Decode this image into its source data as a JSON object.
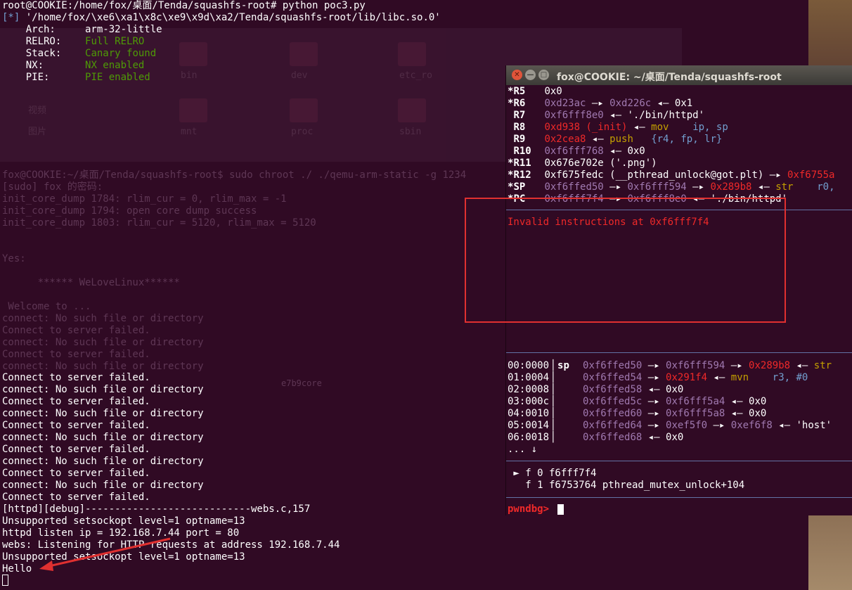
{
  "back_terminal": {
    "lines": [
      "root@COOKIE:/home/fox/桌面/Tenda/squashfs-root# python poc3.py",
      "[*] '/home/fox/\\xe6\\xa1\\x8c\\xe9\\x9d\\xa2/Tenda/squashfs-root/lib/libc.so.0'",
      "    Arch:     arm-32-little",
      "    RELRO:    Full RELRO",
      "    Stack:    Canary found",
      "    NX:       NX enabled",
      "    PIE:      PIE enabled"
    ],
    "ghost": {
      "folders": [
        "bin",
        "dev",
        "etc_ro",
        "mnt",
        "proc",
        "sbin"
      ],
      "sidebar": [
        "视频",
        "图片"
      ],
      "lines": [
        "fox@COOKIE:~/桌面/Tenda/squashfs-root$ sudo chroot ./ ./qemu-arm-static -g 1234",
        "[sudo] fox 的密码:",
        "init_core_dump 1784: rlim_cur = 0, rlim_max = -1",
        "init_core_dump 1794: open core dump success",
        "init_core_dump 1803: rlim_cur = 5120, rlim_max = 5120",
        "Yes:",
        "      ****** WeLoveLinux******",
        " Welcome to ...",
        "connect: No such file or directory",
        "Connect to server failed.",
        "connect: No such file or directory",
        "Connect to server failed.",
        "connect: No such file or directory"
      ],
      "file_label": "e7b9core"
    },
    "output": [
      "Connect to server failed.",
      "connect: No such file or directory",
      "Connect to server failed.",
      "connect: No such file or directory",
      "Connect to server failed.",
      "connect: No such file or directory",
      "Connect to server failed.",
      "connect: No such file or directory",
      "Connect to server failed.",
      "connect: No such file or directory",
      "Connect to server failed.",
      "[httpd][debug]----------------------------webs.c,157",
      "Unsupported setsockopt level=1 optname=13",
      "httpd listen ip = 192.168.7.44 port = 80",
      "webs: Listening for HTTP requests at address 192.168.7.44",
      "Unsupported setsockopt level=1 optname=13",
      "Hello"
    ]
  },
  "gdb_window": {
    "title": "fox@COOKIE: ~/桌面/Tenda/squashfs-root",
    "close_glyph": "✕",
    "min_glyph": "—",
    "max_glyph": "□",
    "registers": [
      {
        "star": "*",
        "name": "R5",
        "parts": [
          {
            "t": "0x0",
            "c": "w"
          }
        ]
      },
      {
        "star": "*",
        "name": "R6",
        "parts": [
          {
            "t": "0xd23ac",
            "c": "p"
          },
          {
            "t": " —▸ ",
            "c": "w"
          },
          {
            "t": "0xd226c",
            "c": "p"
          },
          {
            "t": " ◂— 0x1",
            "c": "w"
          }
        ]
      },
      {
        "star": " ",
        "name": "R7",
        "parts": [
          {
            "t": "0xf6fff8e0",
            "c": "p"
          },
          {
            "t": " ◂— './bin/httpd'",
            "c": "w"
          }
        ]
      },
      {
        "star": " ",
        "name": "R8",
        "parts": [
          {
            "t": "0xd938 (_init)",
            "c": "r"
          },
          {
            "t": " ◂— ",
            "c": "w"
          },
          {
            "t": "mov",
            "c": "y"
          },
          {
            "t": "    ",
            "c": "w"
          },
          {
            "t": "ip, sp",
            "c": "b"
          }
        ]
      },
      {
        "star": " ",
        "name": "R9",
        "parts": [
          {
            "t": "0x2cea8",
            "c": "r"
          },
          {
            "t": " ◂— ",
            "c": "w"
          },
          {
            "t": "push",
            "c": "y"
          },
          {
            "t": "   ",
            "c": "w"
          },
          {
            "t": "{r4, fp, lr}",
            "c": "b"
          }
        ]
      },
      {
        "star": " ",
        "name": "R10",
        "parts": [
          {
            "t": "0xf6fff768",
            "c": "p"
          },
          {
            "t": " ◂— 0x0",
            "c": "w"
          }
        ]
      },
      {
        "star": "*",
        "name": "R11",
        "parts": [
          {
            "t": "0x676e702e ('.png')",
            "c": "w"
          }
        ]
      },
      {
        "star": "*",
        "name": "R12",
        "parts": [
          {
            "t": "0xf675fedc (__pthread_unlock@got.plt) —▸ ",
            "c": "w"
          },
          {
            "t": "0xf6755a",
            "c": "r"
          }
        ]
      },
      {
        "star": "*",
        "name": "SP",
        "parts": [
          {
            "t": "0xf6ffed50",
            "c": "p"
          },
          {
            "t": " —▸ ",
            "c": "w"
          },
          {
            "t": "0xf6fff594",
            "c": "p"
          },
          {
            "t": " —▸ ",
            "c": "w"
          },
          {
            "t": "0x289b8",
            "c": "r"
          },
          {
            "t": " ◂— ",
            "c": "w"
          },
          {
            "t": "str",
            "c": "y"
          },
          {
            "t": "    ",
            "c": "w"
          },
          {
            "t": "r0,",
            "c": "b"
          }
        ]
      },
      {
        "star": "*",
        "name": "PC",
        "parts": [
          {
            "t": "0xf6fff7f4",
            "c": "p"
          },
          {
            "t": " —▸ ",
            "c": "w"
          },
          {
            "t": "0xf6fff8e0",
            "c": "p"
          },
          {
            "t": " ◂— './bin/httpd'",
            "c": "w"
          }
        ]
      }
    ],
    "invalid_msg": "Invalid instructions at 0xf6fff7f4",
    "stack": [
      {
        "off": "00:0000",
        "tag": "sp",
        "parts": [
          {
            "t": "0xf6ffed50",
            "c": "p"
          },
          {
            "t": " —▸ ",
            "c": "w"
          },
          {
            "t": "0xf6fff594",
            "c": "p"
          },
          {
            "t": " —▸ ",
            "c": "w"
          },
          {
            "t": "0x289b8",
            "c": "r"
          },
          {
            "t": " ◂— ",
            "c": "w"
          },
          {
            "t": "str",
            "c": "y"
          }
        ]
      },
      {
        "off": "01:0004",
        "tag": "",
        "parts": [
          {
            "t": "0xf6ffed54",
            "c": "p"
          },
          {
            "t": " —▸ ",
            "c": "w"
          },
          {
            "t": "0x291f4",
            "c": "r"
          },
          {
            "t": " ◂— ",
            "c": "w"
          },
          {
            "t": "mvn",
            "c": "y"
          },
          {
            "t": "    ",
            "c": "w"
          },
          {
            "t": "r3, #0",
            "c": "b"
          }
        ]
      },
      {
        "off": "02:0008",
        "tag": "",
        "parts": [
          {
            "t": "0xf6ffed58",
            "c": "p"
          },
          {
            "t": " ◂— 0x0",
            "c": "w"
          }
        ]
      },
      {
        "off": "03:000c",
        "tag": "",
        "parts": [
          {
            "t": "0xf6ffed5c",
            "c": "p"
          },
          {
            "t": " —▸ ",
            "c": "w"
          },
          {
            "t": "0xf6fff5a4",
            "c": "p"
          },
          {
            "t": " ◂— 0x0",
            "c": "w"
          }
        ]
      },
      {
        "off": "04:0010",
        "tag": "",
        "parts": [
          {
            "t": "0xf6ffed60",
            "c": "p"
          },
          {
            "t": " —▸ ",
            "c": "w"
          },
          {
            "t": "0xf6fff5a8",
            "c": "p"
          },
          {
            "t": " ◂— 0x0",
            "c": "w"
          }
        ]
      },
      {
        "off": "05:0014",
        "tag": "",
        "parts": [
          {
            "t": "0xf6ffed64",
            "c": "p"
          },
          {
            "t": " —▸ ",
            "c": "w"
          },
          {
            "t": "0xef5f0",
            "c": "p"
          },
          {
            "t": " —▸ ",
            "c": "w"
          },
          {
            "t": "0xef6f8",
            "c": "p"
          },
          {
            "t": " ◂— 'host'",
            "c": "w"
          }
        ]
      },
      {
        "off": "06:0018",
        "tag": "",
        "parts": [
          {
            "t": "0xf6ffed68",
            "c": "p"
          },
          {
            "t": " ◂— 0x0",
            "c": "w"
          }
        ]
      }
    ],
    "more": "... ↓",
    "backtrace": [
      " ► f 0 f6fff7f4",
      "   f 1 f6753764 pthread_mutex_unlock+104"
    ],
    "prompt": "pwndbg> "
  },
  "colors": {
    "terminal_bg": "#300a24",
    "address_purple": "#a079b0",
    "heap_red": "#ef2929",
    "instr_yellow": "#c4a000",
    "operand_blue": "#729fcf",
    "annotation_red": "#e03030"
  }
}
